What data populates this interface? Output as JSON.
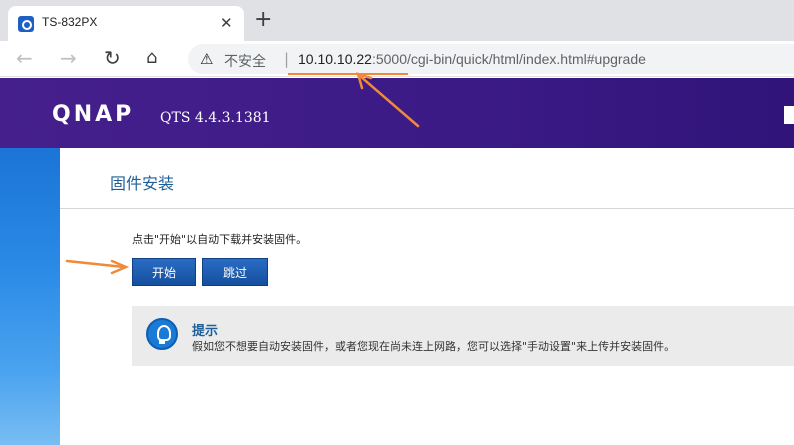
{
  "browser": {
    "tab_title": "TS-832PX",
    "tab_close": "✕",
    "new_tab": "+",
    "security_label": "不安全",
    "separator": "|",
    "url_host": "10.10.10.22",
    "url_rest": ":5000/cgi-bin/quick/html/index.html#upgrade"
  },
  "banner": {
    "logo": "QNAP",
    "version": "QTS 4.4.3.1381"
  },
  "panel": {
    "title": "固件安装",
    "instruction": "点击\"开始\"以自动下载并安装固件。",
    "start_label": "开始",
    "skip_label": "跳过",
    "tip_title": "提示",
    "tip_text": "假如您不想要自动安装固件，或者您现在尚未连上网路，您可以选择\"手动设置\"来上传并安装固件。"
  },
  "colors": {
    "banner": "#45208c",
    "accent_blue": "#1f5f99",
    "button": "#1a5cb0",
    "annotation": "#f08a3a"
  }
}
